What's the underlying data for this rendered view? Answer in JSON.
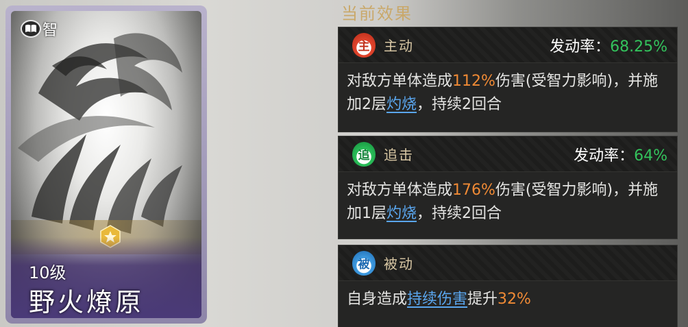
{
  "card": {
    "type_label": "智",
    "type_icon": "book-icon",
    "level": "10级",
    "name": "野火燎原",
    "frame_color": "#8e86a9"
  },
  "panel": {
    "title": "当前效果",
    "effects": [
      {
        "badge": "主",
        "badge_color": "#e2452d",
        "type": "主动",
        "rate_label": "发动率：",
        "rate_value": "68.25%",
        "desc": {
          "p1": "对敌方单体造成",
          "pct": "112%",
          "p2": "伤害(受智力影响)，并施加2层",
          "link": "灼烧",
          "p3": "，持续2回合"
        }
      },
      {
        "badge": "追",
        "badge_color": "#2bbf5a",
        "type": "追击",
        "rate_label": "发动率：",
        "rate_value": "64%",
        "desc": {
          "p1": "对敌方单体造成",
          "pct": "176%",
          "p2": "伤害(受智力影响)，并施加1层",
          "link": "灼烧",
          "p3": "，持续2回合"
        }
      },
      {
        "badge": "被",
        "badge_color": "#3f9be0",
        "type": "被动",
        "desc": {
          "p1": "自身造成",
          "link": "持续伤害",
          "p2": "提升",
          "pct": "32%"
        }
      }
    ]
  },
  "colors": {
    "highlight": "#f08a35",
    "link": "#5aa6ee",
    "rate": "#33c25c",
    "title": "#c9a86a"
  }
}
